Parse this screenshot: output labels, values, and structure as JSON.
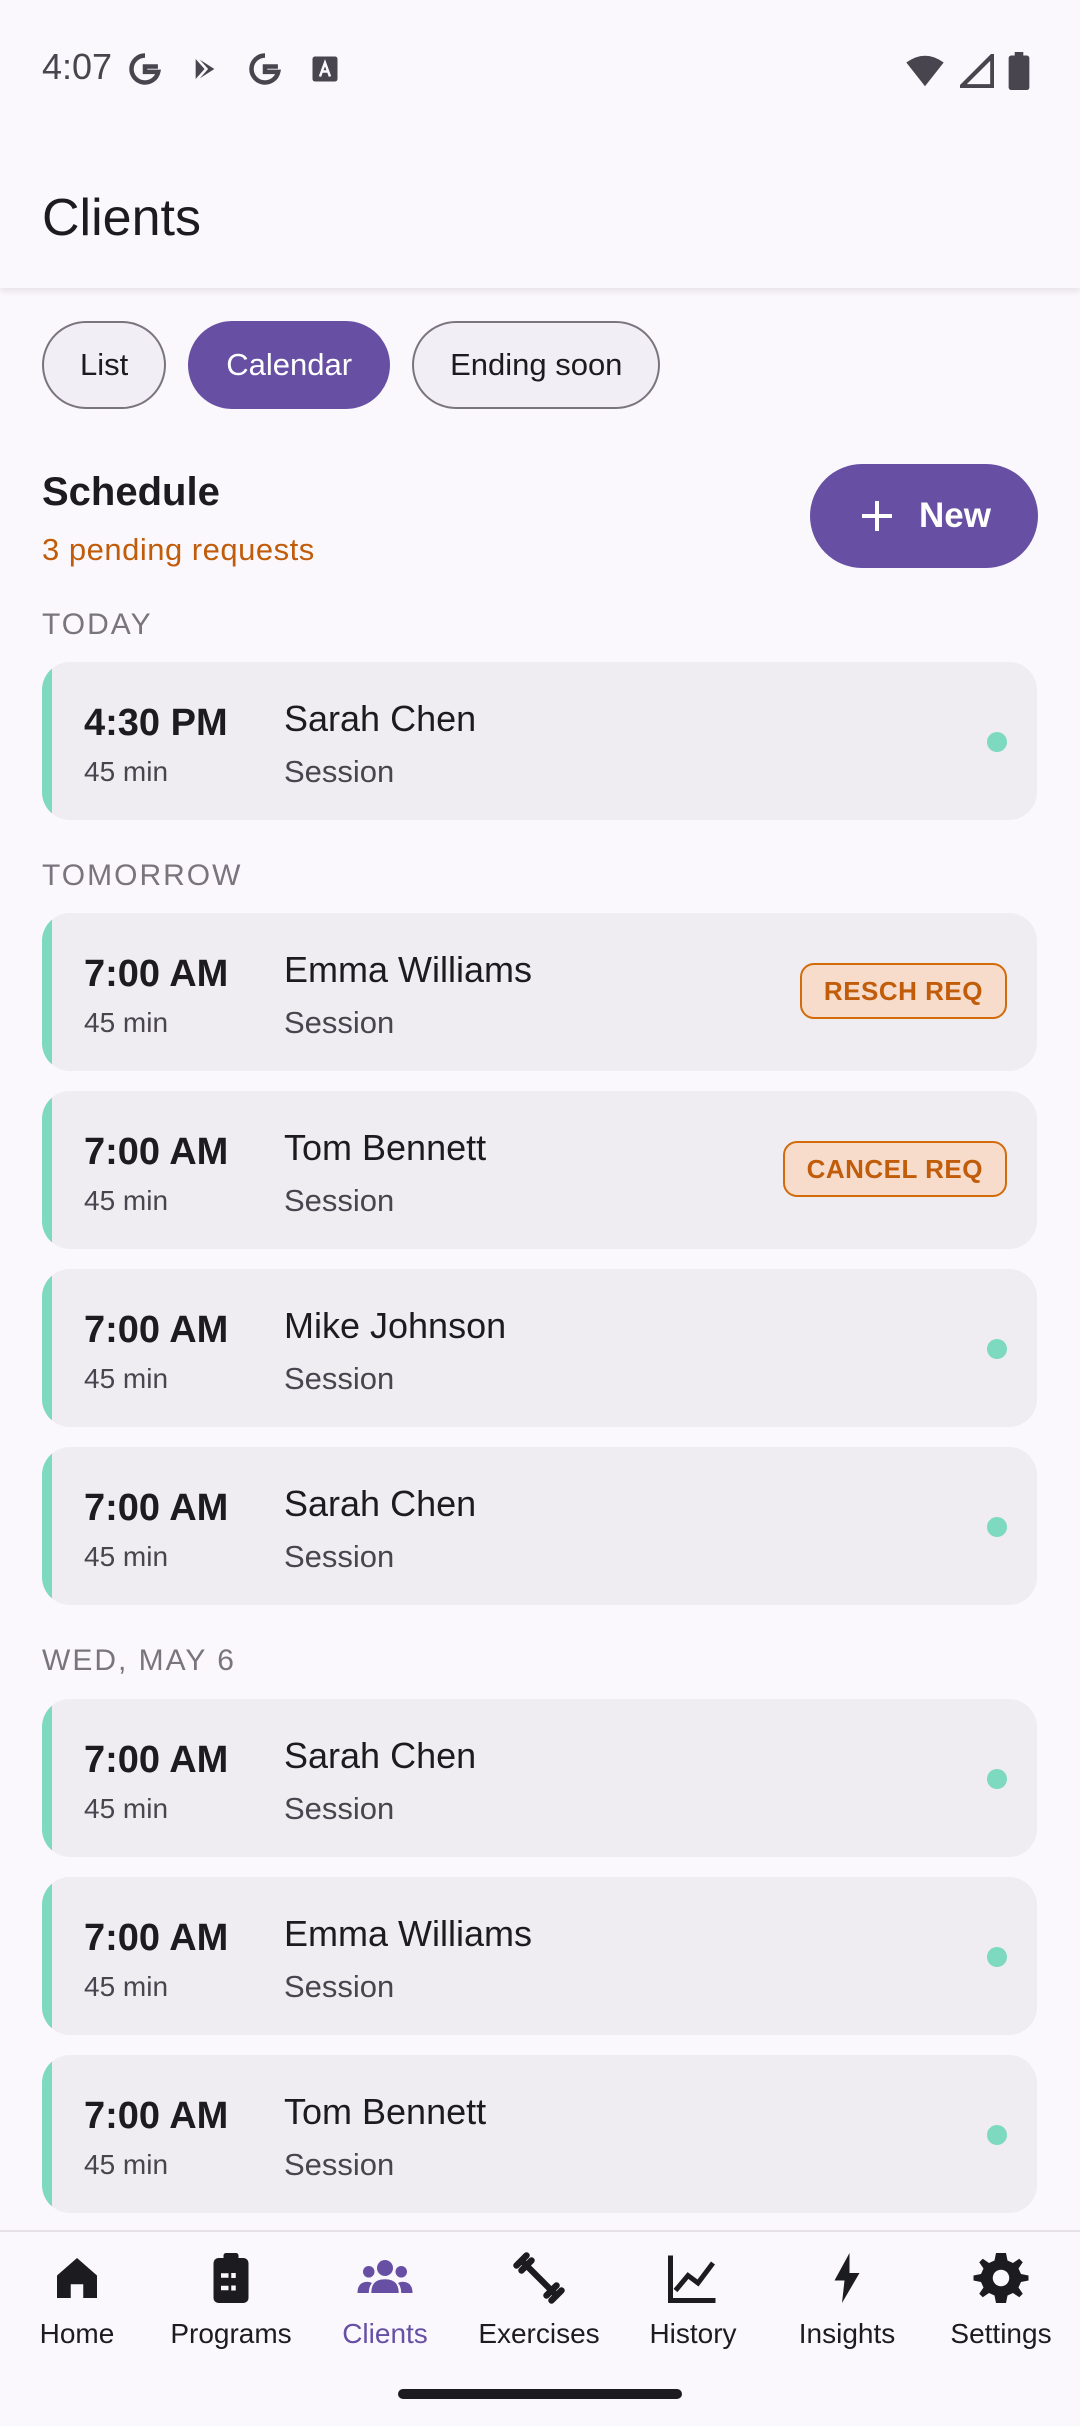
{
  "status": {
    "time": "4:07"
  },
  "app": {
    "title": "Clients"
  },
  "chips": [
    {
      "label": "List",
      "active": false
    },
    {
      "label": "Calendar",
      "active": true
    },
    {
      "label": "Ending soon",
      "active": false
    }
  ],
  "schedule": {
    "title": "Schedule",
    "pending": "3 pending requests",
    "new_label": "New"
  },
  "sections": {
    "today": "TODAY",
    "tomorrow": "TOMORROW",
    "wed": "WED, MAY 6"
  },
  "sessions": [
    {
      "time": "4:30 PM",
      "duration": "45 min",
      "client": "Sarah Chen",
      "type": "Session",
      "status": ""
    },
    {
      "time": "7:00 AM",
      "duration": "45 min",
      "client": "Emma Williams",
      "type": "Session",
      "status": "RESCH REQ"
    },
    {
      "time": "7:00 AM",
      "duration": "45 min",
      "client": "Tom Bennett",
      "type": "Session",
      "status": "CANCEL REQ"
    },
    {
      "time": "7:00 AM",
      "duration": "45 min",
      "client": "Mike Johnson",
      "type": "Session",
      "status": ""
    },
    {
      "time": "7:00 AM",
      "duration": "45 min",
      "client": "Sarah Chen",
      "type": "Session",
      "status": ""
    },
    {
      "time": "7:00 AM",
      "duration": "45 min",
      "client": "Sarah Chen",
      "type": "Session",
      "status": ""
    },
    {
      "time": "7:00 AM",
      "duration": "45 min",
      "client": "Emma Williams",
      "type": "Session",
      "status": ""
    },
    {
      "time": "7:00 AM",
      "duration": "45 min",
      "client": "Tom Bennett",
      "type": "Session",
      "status": ""
    }
  ],
  "nav": [
    {
      "label": "Home",
      "icon": "home-icon"
    },
    {
      "label": "Programs",
      "icon": "clipboard-icon"
    },
    {
      "label": "Clients",
      "icon": "people-icon",
      "active": true
    },
    {
      "label": "Exercises",
      "icon": "dumbbell-icon"
    },
    {
      "label": "History",
      "icon": "chart-line-icon"
    },
    {
      "label": "Insights",
      "icon": "bolt-icon"
    },
    {
      "label": "Settings",
      "icon": "gear-icon"
    }
  ],
  "colors": {
    "primary": "#6750a4",
    "accent": "#7dd9bf",
    "warning": "#c15c0a"
  }
}
